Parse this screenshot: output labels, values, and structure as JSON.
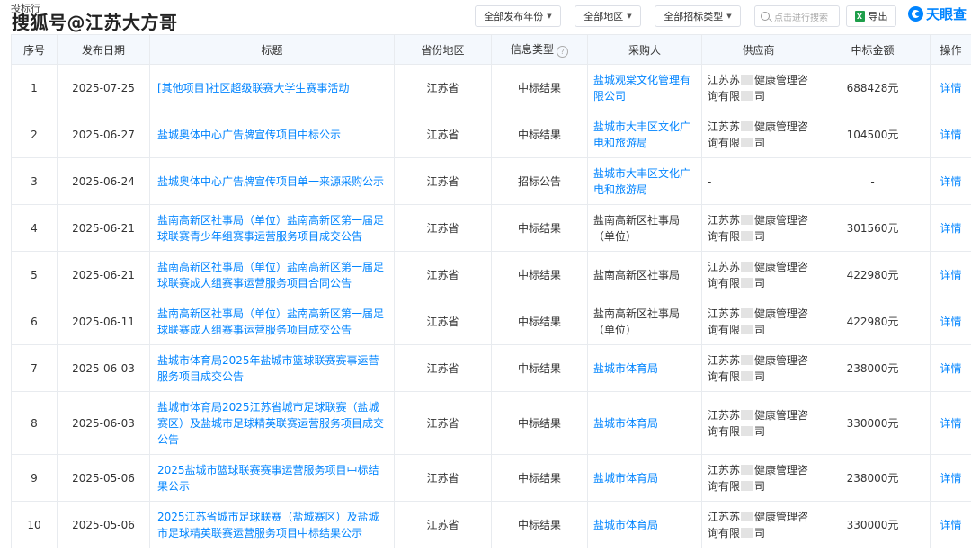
{
  "watermark": {
    "top": "投标行",
    "main": "搜狐号@江苏大方哥"
  },
  "filters": [
    {
      "label": "全部发布年份"
    },
    {
      "label": "全部地区"
    },
    {
      "label": "全部招标类型"
    }
  ],
  "search": {
    "placeholder": "点击进行搜索"
  },
  "export": {
    "label": "导出",
    "icon_text": "X"
  },
  "brand": {
    "name": "天眼查"
  },
  "table": {
    "headers": [
      "序号",
      "发布日期",
      "标题",
      "省份地区",
      "信息类型",
      "采购人",
      "供应商",
      "中标金额",
      "操作"
    ],
    "rows": [
      {
        "no": "1",
        "date": "2025-07-25",
        "title": "[其他项目]社区超级联赛大学生赛事活动",
        "region": "江苏省",
        "type": "中标结果",
        "buyer": "盐城观棠文化管理有限公司",
        "buyer_link": true,
        "supplier": "江苏苏█健康管理咨询有限█司",
        "amount": "688428元",
        "action": "详情"
      },
      {
        "no": "2",
        "date": "2025-06-27",
        "title": "盐城奥体中心广告牌宣传项目中标公示",
        "region": "江苏省",
        "type": "中标结果",
        "buyer": "盐城市大丰区文化广电和旅游局",
        "buyer_link": true,
        "supplier": "江苏苏█健康管理咨询有限█司",
        "amount": "104500元",
        "action": "详情"
      },
      {
        "no": "3",
        "date": "2025-06-24",
        "title": "盐城奥体中心广告牌宣传项目单一来源采购公示",
        "region": "江苏省",
        "type": "招标公告",
        "buyer": "盐城市大丰区文化广电和旅游局",
        "buyer_link": true,
        "supplier": "-",
        "amount": "-",
        "action": "详情"
      },
      {
        "no": "4",
        "date": "2025-06-21",
        "title": "盐南高新区社事局（单位）盐南高新区第一届足球联赛青少年组赛事运营服务项目成交公告",
        "region": "江苏省",
        "type": "中标结果",
        "buyer": "盐南高新区社事局（单位）",
        "buyer_link": false,
        "supplier": "江苏苏█健康管理咨询有限█司",
        "amount": "301560元",
        "action": "详情"
      },
      {
        "no": "5",
        "date": "2025-06-21",
        "title": "盐南高新区社事局（单位）盐南高新区第一届足球联赛成人组赛事运营服务项目合同公告",
        "region": "江苏省",
        "type": "中标结果",
        "buyer": "盐南高新区社事局",
        "buyer_link": false,
        "supplier": "江苏苏█健康管理咨询有限█司",
        "amount": "422980元",
        "action": "详情"
      },
      {
        "no": "6",
        "date": "2025-06-11",
        "title": "盐南高新区社事局（单位）盐南高新区第一届足球联赛成人组赛事运营服务项目成交公告",
        "region": "江苏省",
        "type": "中标结果",
        "buyer": "盐南高新区社事局（单位）",
        "buyer_link": false,
        "supplier": "江苏苏█健康管理咨询有限█司",
        "amount": "422980元",
        "action": "详情"
      },
      {
        "no": "7",
        "date": "2025-06-03",
        "title": "盐城市体育局2025年盐城市篮球联赛赛事运营服务项目成交公告",
        "region": "江苏省",
        "type": "中标结果",
        "buyer": "盐城市体育局",
        "buyer_link": true,
        "supplier": "江苏苏█健康管理咨询有限█司",
        "amount": "238000元",
        "action": "详情"
      },
      {
        "no": "8",
        "date": "2025-06-03",
        "title": "盐城市体育局2025江苏省城市足球联赛（盐城赛区）及盐城市足球精英联赛运营服务项目成交公告",
        "region": "江苏省",
        "type": "中标结果",
        "buyer": "盐城市体育局",
        "buyer_link": true,
        "supplier": "江苏苏█健康管理咨询有限█司",
        "amount": "330000元",
        "action": "详情"
      },
      {
        "no": "9",
        "date": "2025-05-06",
        "title": "2025盐城市篮球联赛赛事运营服务项目中标结果公示",
        "region": "江苏省",
        "type": "中标结果",
        "buyer": "盐城市体育局",
        "buyer_link": true,
        "supplier": "江苏苏█健康管理咨询有限█司",
        "amount": "238000元",
        "action": "详情"
      },
      {
        "no": "10",
        "date": "2025-05-06",
        "title": "2025江苏省城市足球联赛（盐城赛区）及盐城市足球精英联赛运营服务项目中标结果公示",
        "region": "江苏省",
        "type": "中标结果",
        "buyer": "盐城市体育局",
        "buyer_link": true,
        "supplier": "江苏苏█健康管理咨询有限█司",
        "amount": "330000元",
        "action": "详情"
      }
    ]
  },
  "colors": {
    "link": "#0084ff",
    "header_bg": "#f4f8fd",
    "border": "#e8ebef",
    "mask": "#e3e3e3"
  }
}
